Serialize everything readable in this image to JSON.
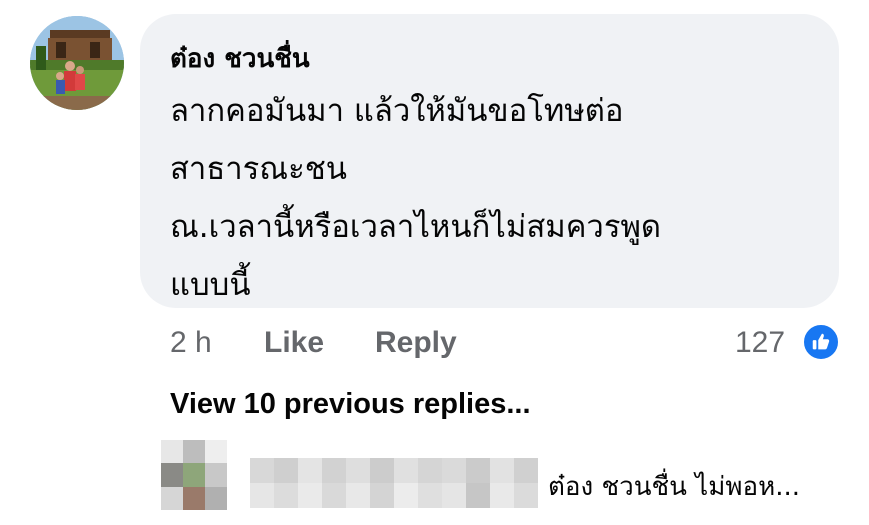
{
  "comment": {
    "author": "ต๋อง ชวนชื่น",
    "lines": [
      "ลากคอมันมา แล้วให้มันขอโทษต่อ",
      "สาธารณะชน",
      "ณ.เวลานี้หรือเวลาไหนก็ไม่สมควรพูด",
      "แบบนี้"
    ],
    "time": "2 h",
    "like_label": "Like",
    "reply_label": "Reply",
    "reaction_count": "127",
    "reaction_icon": "thumbs-up-icon"
  },
  "replies": {
    "view_previous_label": "View 10 previous replies...",
    "latest_reply_preview": "ต๋อง ชวนชื่น ไม่พอห..."
  },
  "colors": {
    "bubble_bg": "#f0f2f5",
    "secondary_text": "#65676b",
    "like_blue": "#1877f2"
  }
}
